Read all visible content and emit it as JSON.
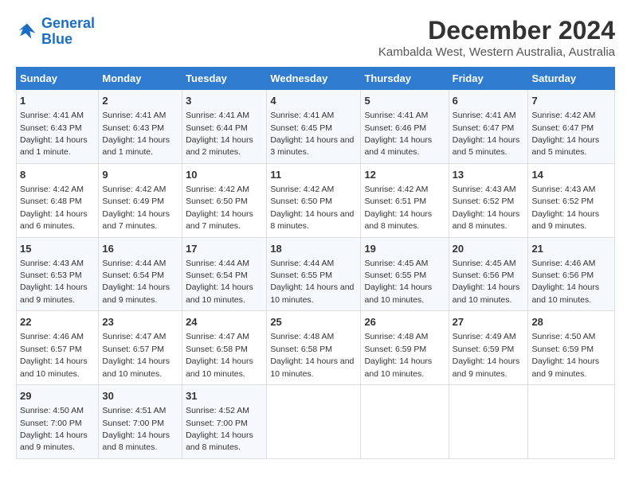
{
  "logo": {
    "line1": "General",
    "line2": "Blue"
  },
  "title": "December 2024",
  "subtitle": "Kambalda West, Western Australia, Australia",
  "days_of_week": [
    "Sunday",
    "Monday",
    "Tuesday",
    "Wednesday",
    "Thursday",
    "Friday",
    "Saturday"
  ],
  "weeks": [
    [
      {
        "day": "1",
        "sunrise": "4:41 AM",
        "sunset": "6:43 PM",
        "daylight": "14 hours and 1 minute."
      },
      {
        "day": "2",
        "sunrise": "4:41 AM",
        "sunset": "6:43 PM",
        "daylight": "14 hours and 1 minute."
      },
      {
        "day": "3",
        "sunrise": "4:41 AM",
        "sunset": "6:44 PM",
        "daylight": "14 hours and 2 minutes."
      },
      {
        "day": "4",
        "sunrise": "4:41 AM",
        "sunset": "6:45 PM",
        "daylight": "14 hours and 3 minutes."
      },
      {
        "day": "5",
        "sunrise": "4:41 AM",
        "sunset": "6:46 PM",
        "daylight": "14 hours and 4 minutes."
      },
      {
        "day": "6",
        "sunrise": "4:41 AM",
        "sunset": "6:47 PM",
        "daylight": "14 hours and 5 minutes."
      },
      {
        "day": "7",
        "sunrise": "4:42 AM",
        "sunset": "6:47 PM",
        "daylight": "14 hours and 5 minutes."
      }
    ],
    [
      {
        "day": "8",
        "sunrise": "4:42 AM",
        "sunset": "6:48 PM",
        "daylight": "14 hours and 6 minutes."
      },
      {
        "day": "9",
        "sunrise": "4:42 AM",
        "sunset": "6:49 PM",
        "daylight": "14 hours and 7 minutes."
      },
      {
        "day": "10",
        "sunrise": "4:42 AM",
        "sunset": "6:50 PM",
        "daylight": "14 hours and 7 minutes."
      },
      {
        "day": "11",
        "sunrise": "4:42 AM",
        "sunset": "6:50 PM",
        "daylight": "14 hours and 8 minutes."
      },
      {
        "day": "12",
        "sunrise": "4:42 AM",
        "sunset": "6:51 PM",
        "daylight": "14 hours and 8 minutes."
      },
      {
        "day": "13",
        "sunrise": "4:43 AM",
        "sunset": "6:52 PM",
        "daylight": "14 hours and 8 minutes."
      },
      {
        "day": "14",
        "sunrise": "4:43 AM",
        "sunset": "6:52 PM",
        "daylight": "14 hours and 9 minutes."
      }
    ],
    [
      {
        "day": "15",
        "sunrise": "4:43 AM",
        "sunset": "6:53 PM",
        "daylight": "14 hours and 9 minutes."
      },
      {
        "day": "16",
        "sunrise": "4:44 AM",
        "sunset": "6:54 PM",
        "daylight": "14 hours and 9 minutes."
      },
      {
        "day": "17",
        "sunrise": "4:44 AM",
        "sunset": "6:54 PM",
        "daylight": "14 hours and 10 minutes."
      },
      {
        "day": "18",
        "sunrise": "4:44 AM",
        "sunset": "6:55 PM",
        "daylight": "14 hours and 10 minutes."
      },
      {
        "day": "19",
        "sunrise": "4:45 AM",
        "sunset": "6:55 PM",
        "daylight": "14 hours and 10 minutes."
      },
      {
        "day": "20",
        "sunrise": "4:45 AM",
        "sunset": "6:56 PM",
        "daylight": "14 hours and 10 minutes."
      },
      {
        "day": "21",
        "sunrise": "4:46 AM",
        "sunset": "6:56 PM",
        "daylight": "14 hours and 10 minutes."
      }
    ],
    [
      {
        "day": "22",
        "sunrise": "4:46 AM",
        "sunset": "6:57 PM",
        "daylight": "14 hours and 10 minutes."
      },
      {
        "day": "23",
        "sunrise": "4:47 AM",
        "sunset": "6:57 PM",
        "daylight": "14 hours and 10 minutes."
      },
      {
        "day": "24",
        "sunrise": "4:47 AM",
        "sunset": "6:58 PM",
        "daylight": "14 hours and 10 minutes."
      },
      {
        "day": "25",
        "sunrise": "4:48 AM",
        "sunset": "6:58 PM",
        "daylight": "14 hours and 10 minutes."
      },
      {
        "day": "26",
        "sunrise": "4:48 AM",
        "sunset": "6:59 PM",
        "daylight": "14 hours and 10 minutes."
      },
      {
        "day": "27",
        "sunrise": "4:49 AM",
        "sunset": "6:59 PM",
        "daylight": "14 hours and 9 minutes."
      },
      {
        "day": "28",
        "sunrise": "4:50 AM",
        "sunset": "6:59 PM",
        "daylight": "14 hours and 9 minutes."
      }
    ],
    [
      {
        "day": "29",
        "sunrise": "4:50 AM",
        "sunset": "7:00 PM",
        "daylight": "14 hours and 9 minutes."
      },
      {
        "day": "30",
        "sunrise": "4:51 AM",
        "sunset": "7:00 PM",
        "daylight": "14 hours and 8 minutes."
      },
      {
        "day": "31",
        "sunrise": "4:52 AM",
        "sunset": "7:00 PM",
        "daylight": "14 hours and 8 minutes."
      },
      null,
      null,
      null,
      null
    ]
  ]
}
